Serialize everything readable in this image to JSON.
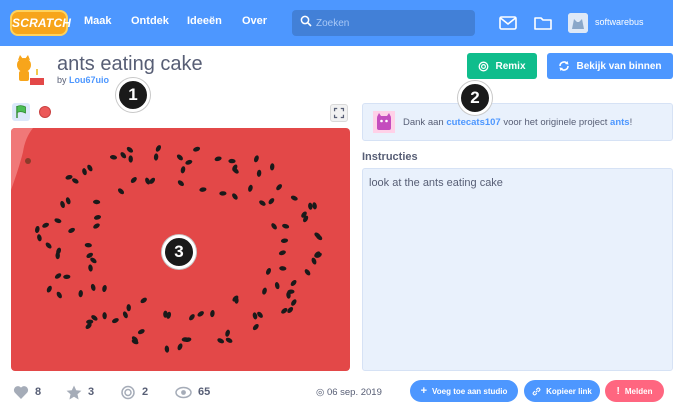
{
  "topbar": {
    "logo": "SCRATCH",
    "nav": [
      "Maak",
      "Ontdek",
      "Ideeën",
      "Over"
    ],
    "search_placeholder": "Zoeken",
    "username": "softwarebus"
  },
  "project": {
    "title": "ants eating cake",
    "by_prefix": "by",
    "author": "Lou67uio"
  },
  "buttons": {
    "remix": "Remix",
    "see_inside": "Bekijk van binnen"
  },
  "credit": {
    "prefix": "Dank aan",
    "user": "cutecats107",
    "middle": "voor het originele project",
    "project": "ants",
    "suffix": "!"
  },
  "instructions": {
    "heading": "Instructies",
    "text": "look at the ants eating cake"
  },
  "stats": {
    "loves": "8",
    "favorites": "3",
    "remixes": "2",
    "views": "65",
    "date": "06 sep. 2019"
  },
  "actions": {
    "add_to_studio": "Voeg toe aan studio",
    "copy_link": "Kopieer link",
    "report": "Melden"
  },
  "callouts": [
    "1",
    "2",
    "3"
  ],
  "colors": {
    "topbar": "#4d97ff",
    "remix": "#0fbd8c",
    "stage_background": "#e34848",
    "report": "#ff6680"
  }
}
